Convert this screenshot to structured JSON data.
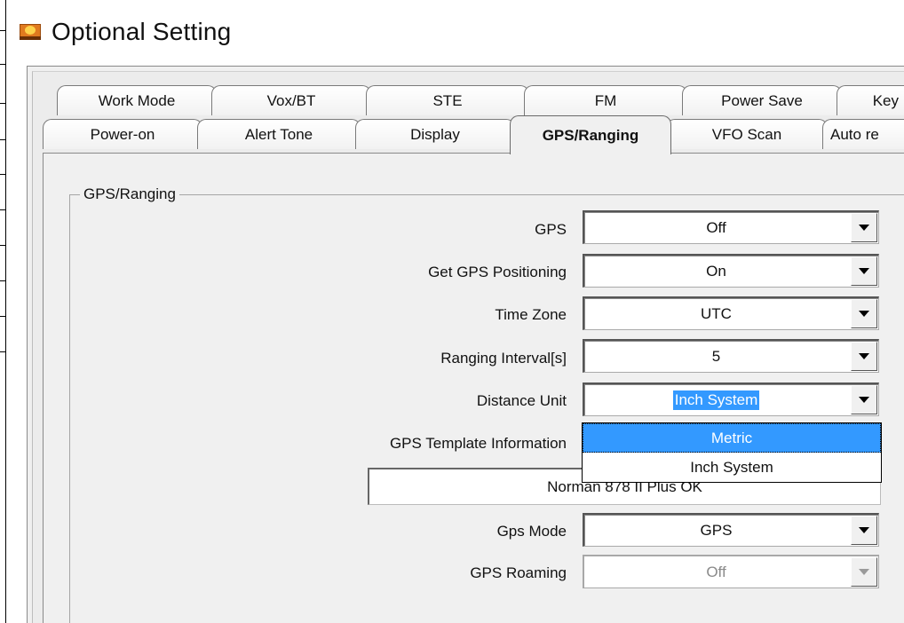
{
  "window": {
    "title": "Optional Setting",
    "icon": "app-logo-icon"
  },
  "tabs_row1": [
    "Work Mode",
    "Vox/BT",
    "STE",
    "FM",
    "Power Save",
    "Key"
  ],
  "tabs_row2": [
    "Power-on",
    "Alert Tone",
    "Display",
    "GPS/Ranging",
    "VFO Scan",
    "Auto re"
  ],
  "active_tab": "GPS/Ranging",
  "group": {
    "label": "GPS/Ranging"
  },
  "fields": {
    "gps": {
      "label": "GPS",
      "value": "Off"
    },
    "get_gps_positioning": {
      "label": "Get GPS Positioning",
      "value": "On"
    },
    "time_zone": {
      "label": "Time Zone",
      "value": "UTC"
    },
    "ranging_interval": {
      "label": "Ranging Interval[s]",
      "value": "5"
    },
    "distance_unit": {
      "label": "Distance Unit",
      "value": "Inch System"
    },
    "gps_template_information": {
      "label": "GPS Template Information",
      "value": "Norman 878 II Plus OK"
    },
    "gps_mode": {
      "label": "Gps Mode",
      "value": "GPS"
    },
    "gps_roaming": {
      "label": "GPS Roaming",
      "value": "Off"
    }
  },
  "distance_unit_dropdown": {
    "options": [
      "Metric",
      "Inch System"
    ],
    "highlighted": "Metric"
  },
  "colors": {
    "selection": "#3399ff",
    "panel": "#f0f0f0",
    "icon": "#e07a1f"
  }
}
